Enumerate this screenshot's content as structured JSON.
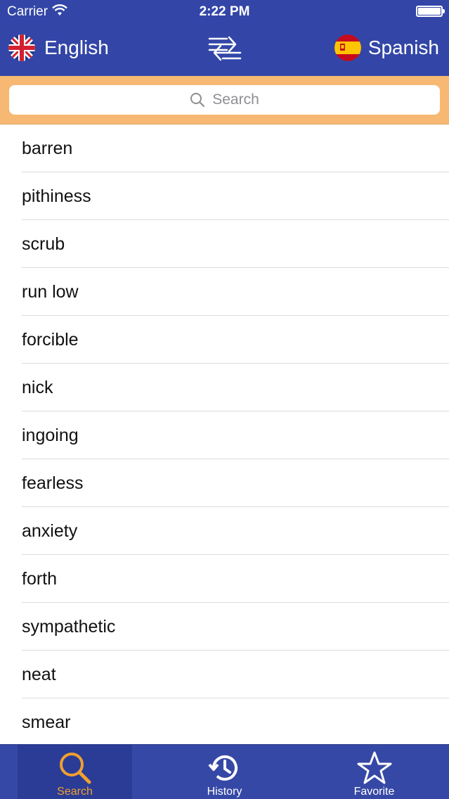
{
  "status_bar": {
    "carrier": "Carrier",
    "time": "2:22 PM"
  },
  "header": {
    "source_language": "English",
    "target_language": "Spanish",
    "source_flag_icon": "uk-flag-icon",
    "target_flag_icon": "spain-flag-icon",
    "swap_icon": "swap-languages-icon"
  },
  "search": {
    "placeholder": "Search"
  },
  "words": [
    "barren",
    "pithiness",
    "scrub",
    "run low",
    "forcible",
    "nick",
    "ingoing",
    "fearless",
    "anxiety",
    "forth",
    "sympathetic",
    "neat",
    "smear"
  ],
  "tabs": [
    {
      "label": "Search",
      "icon": "search-icon",
      "active": true
    },
    {
      "label": "History",
      "icon": "history-icon",
      "active": false
    },
    {
      "label": "Favorite",
      "icon": "star-icon",
      "active": false
    }
  ],
  "colors": {
    "header_blue": "#3346a7",
    "search_bar_orange": "#f6b872",
    "active_tab_orange": "#f0a030"
  }
}
